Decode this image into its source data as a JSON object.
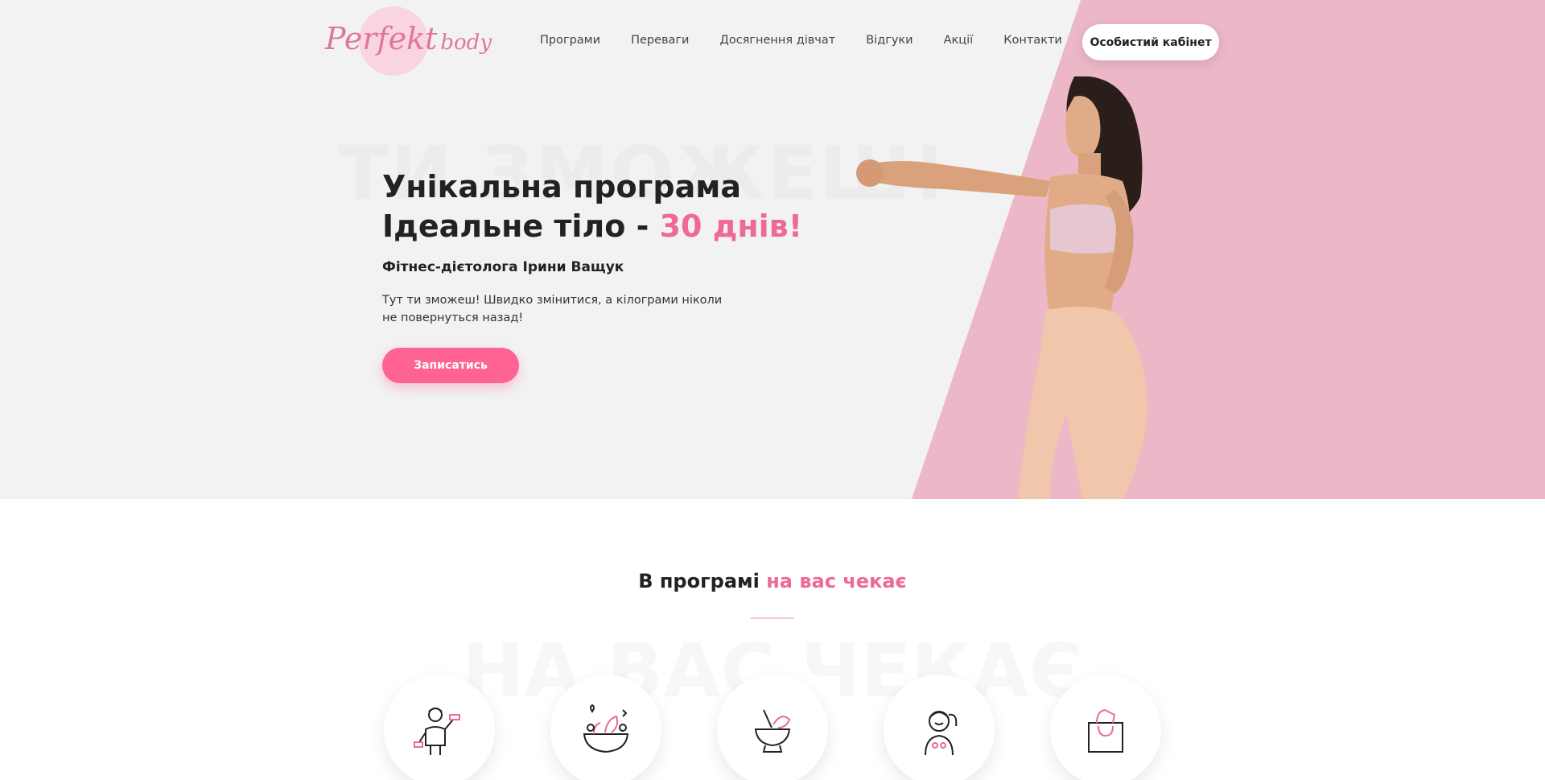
{
  "logo": {
    "word1": "Perfekt",
    "word2": "body"
  },
  "nav": {
    "items": [
      {
        "label": "Програми"
      },
      {
        "label": "Переваги"
      },
      {
        "label": "Досягнення дівчат"
      },
      {
        "label": "Відгуки"
      },
      {
        "label": "Акції"
      },
      {
        "label": "Контакти"
      }
    ],
    "cabinet_label": "Особистий кабінет"
  },
  "hero": {
    "watermark": "ТИ ЗМОЖЕШ!",
    "title_line1": "Унікальна програма",
    "title_line2": "Ідеальне тіло - ",
    "title_accent": "30 днів!",
    "subtitle": "Фітнес-дієтолога Ірини Ващук",
    "description": "Тут ти зможеш! Швидко змінитися, а кілограми ніколи не повернуться назад!",
    "signup_label": "Записатись"
  },
  "section2": {
    "title_main": "В програмі ",
    "title_accent": "на вас чекає",
    "watermark": "НА ВАС ЧЕКАЄ"
  },
  "features": [
    {
      "icon": "fitness-woman-dumbbell-icon"
    },
    {
      "icon": "salad-bowl-icon"
    },
    {
      "icon": "mortar-pestle-icon"
    },
    {
      "icon": "smiling-woman-icon"
    },
    {
      "icon": "shopping-bag-icon"
    }
  ],
  "colors": {
    "accent": "#ee6a93",
    "button": "#ff6393",
    "hero_pink": "#ecb7c7",
    "hero_bg": "#f2f2f2"
  }
}
